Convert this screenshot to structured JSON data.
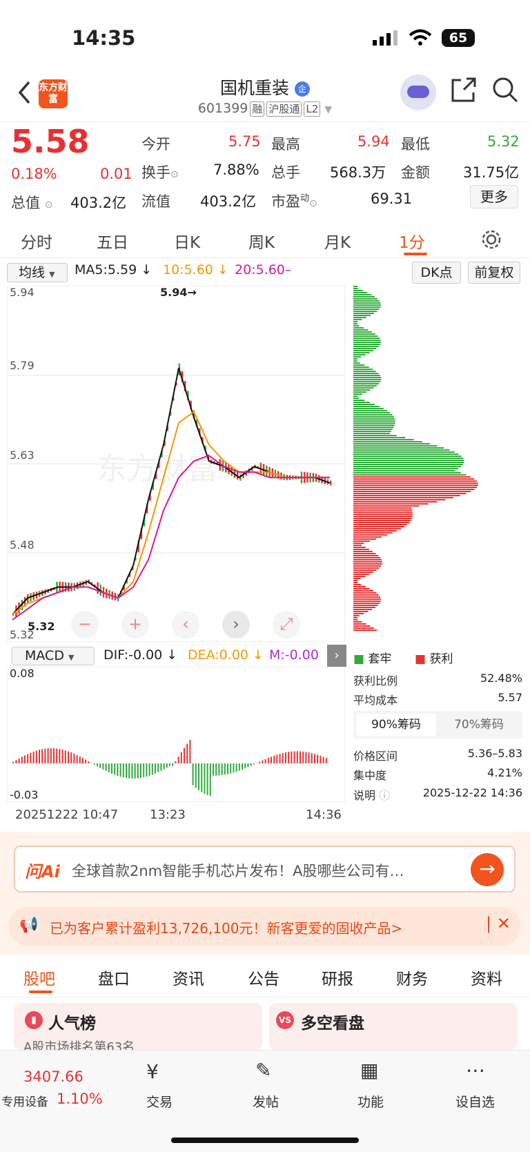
{
  "status": {
    "time": "14:35",
    "battery": "65"
  },
  "header": {
    "logo": "东方财富",
    "name": "国机重装",
    "badge": "企",
    "code": "601399",
    "tags": [
      "融",
      "沪股通",
      "L2"
    ]
  },
  "quote": {
    "price": "5.58",
    "pct": "0.18%",
    "chg": "0.01",
    "open_l": "今开",
    "open": "5.75",
    "high_l": "最高",
    "high": "5.94",
    "low_l": "最低",
    "low": "5.32",
    "turn_l": "换手",
    "turn": "7.88%",
    "vol_l": "总手",
    "vol": "568.3万",
    "amt_l": "金额",
    "amt": "31.75亿",
    "mcap_l": "总值",
    "mcap": "403.2亿",
    "float_l": "流值",
    "float": "403.2亿",
    "pe_l": "市盈",
    "pe_sup": "动",
    "pe": "69.31",
    "more": "更多"
  },
  "tabs": [
    "分时",
    "五日",
    "日K",
    "周K",
    "月K",
    "1分"
  ],
  "ma": {
    "sel": "均线",
    "ma5": "MA5:5.59",
    "ma10": "10:5.60",
    "ma20": "20:5.60–",
    "dk": "DK点",
    "fq": "前复权"
  },
  "yaxis": [
    "5.94",
    "5.79",
    "5.63",
    "5.48",
    "5.32"
  ],
  "peak": "5.94→",
  "lowmark": "5.32",
  "macd": {
    "sel": "MACD",
    "dif": "DIF:-0.00",
    "dea": "DEA:0.00",
    "m": "M:-0.00",
    "top": "0.08",
    "bot": "-0.03"
  },
  "xaxis": [
    "20251222 10:47",
    "13:23",
    "14:36"
  ],
  "chips": {
    "trap": "套牢",
    "profit": "获利",
    "ratio_l": "获利比例",
    "ratio": "52.48%",
    "avg_l": "平均成本",
    "avg": "5.57",
    "t90": "90%筹码",
    "t70": "70%筹码",
    "range_l": "价格区间",
    "range": "5.36–5.83",
    "conc_l": "集中度",
    "conc": "4.21%",
    "note_l": "说明",
    "note": "2025-12-22 14:36"
  },
  "ai": {
    "label": "问Ai",
    "text": "全球首款2nm智能手机芯片发布！A股哪些公司有…"
  },
  "banner": "已为客户累计盈利13,726,100元！新客更爱的固收产品>",
  "subtabs": [
    "股吧",
    "盘口",
    "资讯",
    "公告",
    "研报",
    "财务",
    "资料"
  ],
  "cards": {
    "left": "人气榜",
    "left_sub": "A股市场排名第63名",
    "right": "多空看盘"
  },
  "bottom": {
    "index": "3407.66",
    "device": "专用设备",
    "dpct": "1.10%",
    "items": [
      "交易",
      "发帖",
      "功能",
      "设自选"
    ]
  },
  "colors": {
    "red": "#e93030",
    "green": "#2eab3a",
    "orange": "#f39800",
    "pink": "#d6189a"
  },
  "chart_data": {
    "type": "line",
    "series": [
      {
        "name": "MA5",
        "values": [
          5.35,
          5.38,
          5.39,
          5.4,
          5.4,
          5.41,
          5.39,
          5.38,
          5.44,
          5.56,
          5.66,
          5.8,
          5.71,
          5.63,
          5.62,
          5.6,
          5.62,
          5.61,
          5.6,
          5.6,
          5.6,
          5.59
        ]
      },
      {
        "name": "10",
        "values": [
          5.35,
          5.37,
          5.38,
          5.39,
          5.4,
          5.4,
          5.39,
          5.38,
          5.41,
          5.5,
          5.6,
          5.7,
          5.72,
          5.66,
          5.63,
          5.61,
          5.61,
          5.61,
          5.6,
          5.6,
          5.6,
          5.6
        ]
      },
      {
        "name": "20",
        "values": [
          5.34,
          5.36,
          5.38,
          5.39,
          5.4,
          5.4,
          5.39,
          5.38,
          5.4,
          5.45,
          5.54,
          5.6,
          5.63,
          5.64,
          5.62,
          5.61,
          5.61,
          5.6,
          5.6,
          5.6,
          5.6,
          5.6
        ]
      }
    ],
    "ylim": [
      5.32,
      5.94
    ]
  }
}
